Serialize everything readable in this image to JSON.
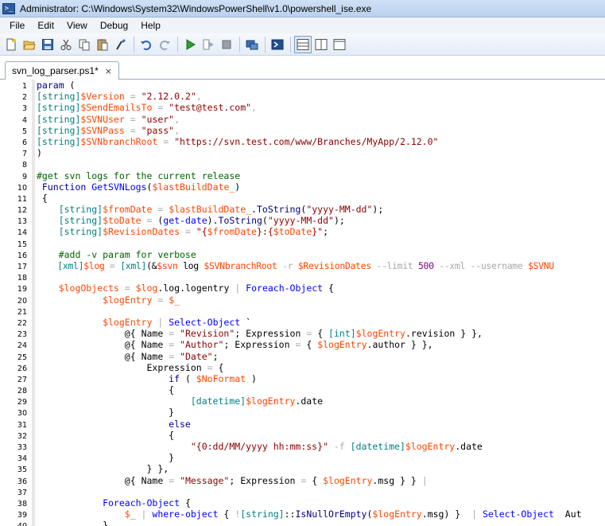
{
  "window": {
    "title": "Administrator: C:\\Windows\\System32\\WindowsPowerShell\\v1.0\\powershell_ise.exe"
  },
  "menu": [
    "File",
    "Edit",
    "View",
    "Debug",
    "Help"
  ],
  "toolbar": {
    "icons": [
      "new-script-icon",
      "open-icon",
      "save-icon",
      "cut-icon",
      "copy-icon",
      "paste-icon",
      "clear-icon",
      "undo-icon",
      "redo-icon",
      "run-icon",
      "run-selection-icon",
      "stop-icon",
      "remote-powershell-icon",
      "launch-powershell-icon",
      "script-pane-top-icon",
      "script-pane-right-icon",
      "script-pane-max-icon"
    ]
  },
  "tab": {
    "label": "svn_log_parser.ps1*",
    "close": "×"
  },
  "colors": {
    "keyword": "#00008b",
    "type": "#008080",
    "variable": "#ff4500",
    "string": "#8b0000",
    "comment": "#006400",
    "command": "#0000ff",
    "operator": "#a9a9a9",
    "number": "#800080"
  },
  "lines": [
    {
      "n": "1",
      "tokens": [
        [
          "k",
          "param"
        ],
        [
          "p",
          " ("
        ]
      ]
    },
    {
      "n": "2",
      "tokens": [
        [
          "t",
          "[string]"
        ],
        [
          "v",
          "$Version"
        ],
        [
          "op",
          " = "
        ],
        [
          "s",
          "\"2.12.0.2\""
        ],
        [
          "op",
          ","
        ]
      ]
    },
    {
      "n": "3",
      "tokens": [
        [
          "t",
          "[string]"
        ],
        [
          "v",
          "$SendEmailsTo"
        ],
        [
          "op",
          " = "
        ],
        [
          "s",
          "\"test@test.com\""
        ],
        [
          "op",
          ","
        ]
      ]
    },
    {
      "n": "4",
      "tokens": [
        [
          "t",
          "[string]"
        ],
        [
          "v",
          "$SVNUser"
        ],
        [
          "op",
          " = "
        ],
        [
          "s",
          "\"user\""
        ],
        [
          "op",
          ","
        ]
      ]
    },
    {
      "n": "5",
      "tokens": [
        [
          "t",
          "[string]"
        ],
        [
          "v",
          "$SVNPass"
        ],
        [
          "op",
          " = "
        ],
        [
          "s",
          "\"pass\""
        ],
        [
          "op",
          ","
        ]
      ]
    },
    {
      "n": "6",
      "tokens": [
        [
          "t",
          "[string]"
        ],
        [
          "v",
          "$SVNbranchRoot"
        ],
        [
          "op",
          " = "
        ],
        [
          "s",
          "\"https://svn.test.com/www/Branches/MyApp/2.12.0\""
        ]
      ]
    },
    {
      "n": "7",
      "tokens": [
        [
          "p",
          ")"
        ]
      ]
    },
    {
      "n": "8",
      "tokens": []
    },
    {
      "n": "9",
      "tokens": [
        [
          "c",
          "#get svn logs for the current release"
        ]
      ]
    },
    {
      "n": "10",
      "tokens": [
        [
          "k",
          " Function "
        ],
        [
          "cmd",
          "GetSVNLogs"
        ],
        [
          "p",
          "("
        ],
        [
          "v",
          "$lastBuildDate_"
        ],
        [
          "p",
          ")"
        ]
      ]
    },
    {
      "n": "11",
      "tokens": [
        [
          "p",
          " {"
        ]
      ]
    },
    {
      "n": "12",
      "tokens": [
        [
          "t",
          "    [string]"
        ],
        [
          "v",
          "$fromDate"
        ],
        [
          "op",
          " = "
        ],
        [
          "v",
          "$lastBuildDate_"
        ],
        [
          "p",
          "."
        ],
        [
          "a",
          "ToString"
        ],
        [
          "p",
          "("
        ],
        [
          "s",
          "\"yyyy-MM-dd\""
        ],
        [
          "p",
          ");"
        ]
      ]
    },
    {
      "n": "13",
      "tokens": [
        [
          "t",
          "    [string]"
        ],
        [
          "v",
          "$toDate"
        ],
        [
          "op",
          " = "
        ],
        [
          "p",
          "("
        ],
        [
          "cmd",
          "get-date"
        ],
        [
          "p",
          ")."
        ],
        [
          "a",
          "ToString"
        ],
        [
          "p",
          "("
        ],
        [
          "s",
          "\"yyyy-MM-dd\""
        ],
        [
          "p",
          ");"
        ]
      ]
    },
    {
      "n": "14",
      "tokens": [
        [
          "t",
          "    [string]"
        ],
        [
          "v",
          "$RevisionDates"
        ],
        [
          "op",
          " = "
        ],
        [
          "s",
          "\"{"
        ],
        [
          "v",
          "$fromDate"
        ],
        [
          "s",
          "}:{"
        ],
        [
          "v",
          "$toDate"
        ],
        [
          "s",
          "}\""
        ],
        [
          "p",
          ";"
        ]
      ]
    },
    {
      "n": "15",
      "tokens": []
    },
    {
      "n": "16",
      "tokens": [
        [
          "c",
          "    #add -v param for verbose"
        ]
      ]
    },
    {
      "n": "17",
      "lt": true,
      "tokens": [
        [
          "t",
          "    [xml]"
        ],
        [
          "v",
          "$log"
        ],
        [
          "op",
          " = "
        ],
        [
          "t",
          "[xml]"
        ],
        [
          "p",
          "(&"
        ],
        [
          "v",
          "$svn"
        ],
        [
          "p",
          " log "
        ],
        [
          "v",
          "$SVNbranchRoot"
        ],
        [
          "op",
          " -r "
        ],
        [
          "v",
          "$RevisionDates"
        ],
        [
          "op",
          " --limit "
        ],
        [
          "n",
          "500"
        ],
        [
          "op",
          " --xml --username "
        ],
        [
          "v",
          "$SVNU"
        ]
      ]
    },
    {
      "n": "18",
      "tokens": []
    },
    {
      "n": "19",
      "tokens": [
        [
          "v",
          "    $logObjects"
        ],
        [
          "op",
          " = "
        ],
        [
          "v",
          "$log"
        ],
        [
          "p",
          "."
        ],
        [
          "pr",
          "log"
        ],
        [
          "p",
          "."
        ],
        [
          "pr",
          "logentry"
        ],
        [
          "op",
          " | "
        ],
        [
          "cmd",
          "Foreach-Object"
        ],
        [
          "p",
          " {"
        ]
      ]
    },
    {
      "n": "20",
      "tokens": [
        [
          "v",
          "            $logEntry"
        ],
        [
          "op",
          " = "
        ],
        [
          "v",
          "$_"
        ]
      ]
    },
    {
      "n": "21",
      "tokens": []
    },
    {
      "n": "22",
      "tokens": [
        [
          "v",
          "            $logEntry"
        ],
        [
          "op",
          " | "
        ],
        [
          "cmd",
          "Select-Object"
        ],
        [
          "p",
          " `"
        ]
      ]
    },
    {
      "n": "23",
      "tokens": [
        [
          "p",
          "                @{ "
        ],
        [
          "pr",
          "Name"
        ],
        [
          "op",
          " = "
        ],
        [
          "s",
          "\"Revision\""
        ],
        [
          "p",
          "; "
        ],
        [
          "pr",
          "Expression"
        ],
        [
          "op",
          " = "
        ],
        [
          "p",
          "{ "
        ],
        [
          "t",
          "[int]"
        ],
        [
          "v",
          "$logEntry"
        ],
        [
          "p",
          "."
        ],
        [
          "pr",
          "revision"
        ],
        [
          "p",
          " } },"
        ]
      ]
    },
    {
      "n": "24",
      "tokens": [
        [
          "p",
          "                @{ "
        ],
        [
          "pr",
          "Name"
        ],
        [
          "op",
          " = "
        ],
        [
          "s",
          "\"Author\""
        ],
        [
          "p",
          "; "
        ],
        [
          "pr",
          "Expression"
        ],
        [
          "op",
          " = "
        ],
        [
          "p",
          "{ "
        ],
        [
          "v",
          "$logEntry"
        ],
        [
          "p",
          "."
        ],
        [
          "pr",
          "author"
        ],
        [
          "p",
          " } },"
        ]
      ]
    },
    {
      "n": "25",
      "tokens": [
        [
          "p",
          "                @{ "
        ],
        [
          "pr",
          "Name"
        ],
        [
          "op",
          " = "
        ],
        [
          "s",
          "\"Date\""
        ],
        [
          "p",
          ";"
        ]
      ]
    },
    {
      "n": "26",
      "tokens": [
        [
          "pr",
          "                    Expression"
        ],
        [
          "op",
          " = "
        ],
        [
          "p",
          "{"
        ]
      ]
    },
    {
      "n": "27",
      "tokens": [
        [
          "k",
          "                        if"
        ],
        [
          "p",
          " ( "
        ],
        [
          "v",
          "$NoFormat"
        ],
        [
          "p",
          " )"
        ]
      ]
    },
    {
      "n": "28",
      "tokens": [
        [
          "p",
          "                        {"
        ]
      ]
    },
    {
      "n": "29",
      "tokens": [
        [
          "t",
          "                            [datetime]"
        ],
        [
          "v",
          "$logEntry"
        ],
        [
          "p",
          "."
        ],
        [
          "pr",
          "date"
        ]
      ]
    },
    {
      "n": "30",
      "tokens": [
        [
          "p",
          "                        }"
        ]
      ]
    },
    {
      "n": "31",
      "tokens": [
        [
          "k",
          "                        else"
        ]
      ]
    },
    {
      "n": "32",
      "tokens": [
        [
          "p",
          "                        {"
        ]
      ]
    },
    {
      "n": "33",
      "tokens": [
        [
          "s",
          "                            \"{0:dd/MM/yyyy hh:mm:ss}\""
        ],
        [
          "op",
          " -f "
        ],
        [
          "t",
          "[datetime]"
        ],
        [
          "v",
          "$logEntry"
        ],
        [
          "p",
          "."
        ],
        [
          "pr",
          "date"
        ]
      ]
    },
    {
      "n": "34",
      "tokens": [
        [
          "p",
          "                        }"
        ]
      ]
    },
    {
      "n": "35",
      "tokens": [
        [
          "p",
          "                    } },"
        ]
      ]
    },
    {
      "n": "36",
      "tokens": [
        [
          "p",
          "                @{ "
        ],
        [
          "pr",
          "Name"
        ],
        [
          "op",
          " = "
        ],
        [
          "s",
          "\"Message\""
        ],
        [
          "p",
          "; "
        ],
        [
          "pr",
          "Expression"
        ],
        [
          "op",
          " = "
        ],
        [
          "p",
          "{ "
        ],
        [
          "v",
          "$logEntry"
        ],
        [
          "p",
          "."
        ],
        [
          "pr",
          "msg"
        ],
        [
          "p",
          " } } "
        ],
        [
          "op",
          "|"
        ]
      ]
    },
    {
      "n": "37",
      "tokens": []
    },
    {
      "n": "38",
      "tokens": [
        [
          "cmd",
          "            Foreach-Object"
        ],
        [
          "p",
          " {"
        ]
      ]
    },
    {
      "n": "39",
      "tokens": [
        [
          "v",
          "                $_"
        ],
        [
          "op",
          " | "
        ],
        [
          "cmd",
          "where-object"
        ],
        [
          "p",
          " { "
        ],
        [
          "op",
          "!"
        ],
        [
          "t",
          "[string]"
        ],
        [
          "p",
          "::"
        ],
        [
          "a",
          "IsNullOrEmpty"
        ],
        [
          "p",
          "("
        ],
        [
          "v",
          "$logEntry"
        ],
        [
          "p",
          "."
        ],
        [
          "pr",
          "msg"
        ],
        [
          "p",
          ") }  "
        ],
        [
          "op",
          "| "
        ],
        [
          "cmd",
          "Select-Object"
        ],
        [
          "pr",
          "  Aut"
        ]
      ]
    },
    {
      "n": "40",
      "tokens": [
        [
          "p",
          "            }"
        ]
      ]
    }
  ]
}
